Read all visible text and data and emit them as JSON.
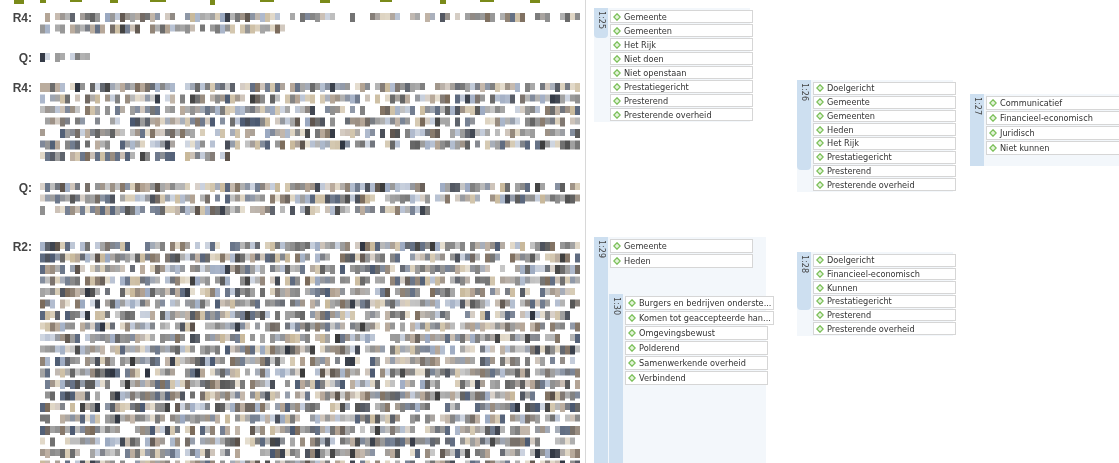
{
  "transcript": [
    {
      "speaker": "R4:",
      "kind": "redacted"
    },
    {
      "speaker": "Q:",
      "kind": "redacted"
    },
    {
      "speaker": "R4:",
      "kind": "redacted"
    },
    {
      "speaker": "Q:",
      "kind": "redacted"
    },
    {
      "speaker": "R2:",
      "kind": "redacted"
    }
  ],
  "quotations": [
    {
      "id_label": "1:25",
      "codes": [
        "Gemeente",
        "Gemeenten",
        "Het Rijk",
        "Niet doen",
        "Niet openstaan",
        "Prestatiegericht",
        "Presterend",
        "Presterende overheid"
      ]
    },
    {
      "id_label": "1:26",
      "codes": [
        "Doelgericht",
        "Gemeente",
        "Gemeenten",
        "Heden",
        "Het Rijk",
        "Prestatiegericht",
        "Presterend",
        "Presterende overheid"
      ]
    },
    {
      "id_label": "1:27",
      "codes": [
        "Communicatief",
        "Financieel-economisch",
        "Juridisch",
        "Niet kunnen"
      ]
    },
    {
      "id_label": "1:29",
      "codes": [
        "Gemeente",
        "Heden"
      ]
    },
    {
      "id_label": "1:30",
      "codes": [
        "Burgers en bedrijven onderste...",
        "Komen tot geaccepteerde han...",
        "Omgevingsbewust",
        "Polderend",
        "Samenwerkende overheid",
        "Verbindend"
      ]
    },
    {
      "id_label": "1:28",
      "codes": [
        "Doelgericht",
        "Financieel-economisch",
        "Kunnen",
        "Prestatiegericht",
        "Presterend",
        "Presterende overheid"
      ]
    }
  ]
}
